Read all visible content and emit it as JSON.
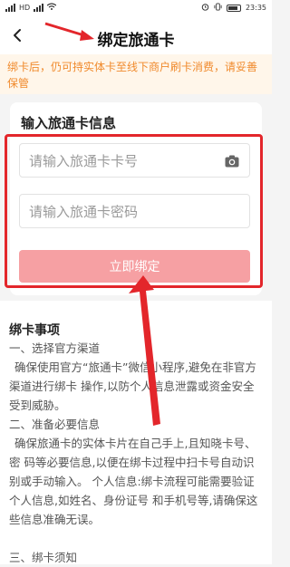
{
  "status": {
    "carrier_left": "HD",
    "time": "23:35",
    "battery_level": 0.7
  },
  "nav": {
    "back_icon": "back-arrow-icon",
    "title": "绑定旅通卡"
  },
  "notice": {
    "text": "绑卡后，仍可持实体卡至线下商户刷卡消费，请妥善保管"
  },
  "form": {
    "title": "输入旅通卡信息",
    "card_number_placeholder": "请输入旅通卡卡号",
    "card_password_placeholder": "请输入旅通卡密码",
    "camera_icon": "camera-icon",
    "bind_button_label": "立即绑定",
    "bind_button_color": "#f6a0a3"
  },
  "notes": {
    "title": "绑卡事项",
    "item1_heading": "一、选择官方渠道",
    "item1_body": "确保使用官方“旅通卡”微信小程序,避免在非官方渠道进行绑卡 操作,以防个人信息泄露或资金安全受到威胁。",
    "item2_heading": "二、准备必要信息",
    "item2_body": "确保旅通卡的实体卡片在自己手上,且知晓卡号、密 码等必要信息,以便在绑卡过程中扫卡号自动识别或手动输入。 个人信息:绑卡流程可能需要验证个人信息,如姓名、身份证号 和手机号等,请确保这些信息准确无误。",
    "item3_heading": "三、绑卡须知"
  },
  "annotation": {
    "highlight_color": "#e3262b"
  }
}
